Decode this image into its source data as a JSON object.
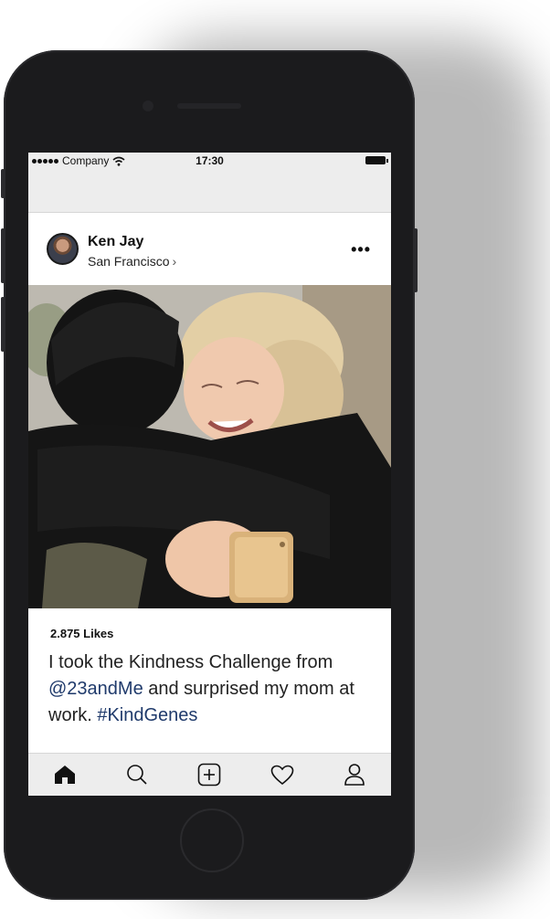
{
  "status_bar": {
    "carrier": "Company",
    "time": "17:30"
  },
  "post": {
    "username": "Ken Jay",
    "location": "San Francisco",
    "location_chevron": "›",
    "more_label": "•••",
    "likes": "2.875 Likes",
    "caption_before": "I took the Kindness Challenge from ",
    "mention": "@23andMe",
    "caption_middle": " and surprised my mom at work. ",
    "hashtag": "#KindGenes"
  },
  "tabbar": {
    "items": [
      "home-icon",
      "search-icon",
      "add-post-icon",
      "heart-icon",
      "profile-icon"
    ]
  },
  "colors": {
    "link": "#1f3a6b",
    "phone_body": "#1b1b1d",
    "bar_background": "#ededed"
  }
}
